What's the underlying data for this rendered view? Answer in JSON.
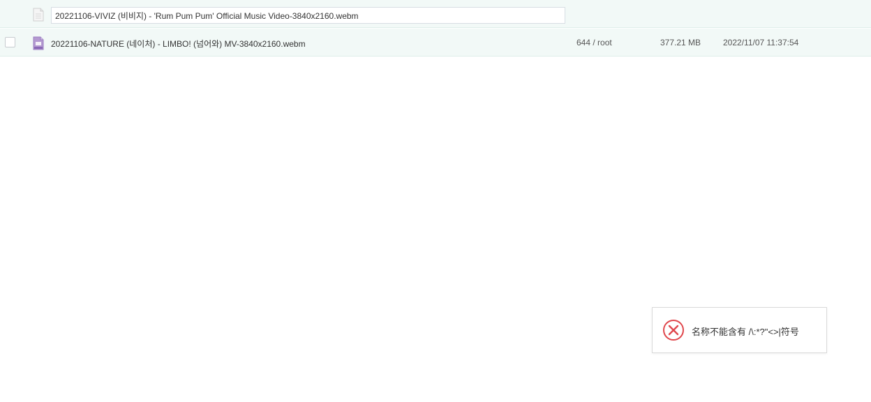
{
  "rename_row": {
    "input_value": "20221106-VIVIZ (비비지) - 'Rum Pum Pum' Official Music Video-3840x2160.webm",
    "icon": "document-icon"
  },
  "file_row": {
    "name": "20221106-NATURE (네이처) - LIMBO! (넘어와) MV-3840x2160.webm",
    "permission": "644 / root",
    "size": "377.21 MB",
    "modified": "2022/11/07 11:37:54",
    "icon": "video-file-icon"
  },
  "toast": {
    "message": "名称不能含有 /\\:*?\"<>|符号",
    "icon": "error-circle-icon",
    "color": "#e0474c"
  }
}
